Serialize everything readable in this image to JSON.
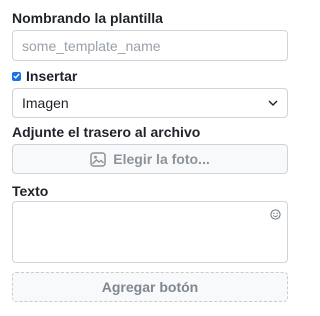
{
  "template_name": {
    "label": "Nombrando la plantilla",
    "placeholder": "some_template_name",
    "value": ""
  },
  "insert": {
    "checked": true,
    "label": "Insertar",
    "selected_option": "Imagen",
    "icon": "chevron-down-icon"
  },
  "attachment": {
    "label": "Adjunte el trasero al archivo",
    "button_label": "Elegir la foto...",
    "icon": "image-icon"
  },
  "text": {
    "label": "Texto",
    "value": "",
    "icon": "emoji-icon"
  },
  "add_button": {
    "label": "Agregar botón"
  },
  "colors": {
    "accent": "#1a73e8",
    "border": "#cfd4db",
    "muted_text": "#8b949c"
  }
}
